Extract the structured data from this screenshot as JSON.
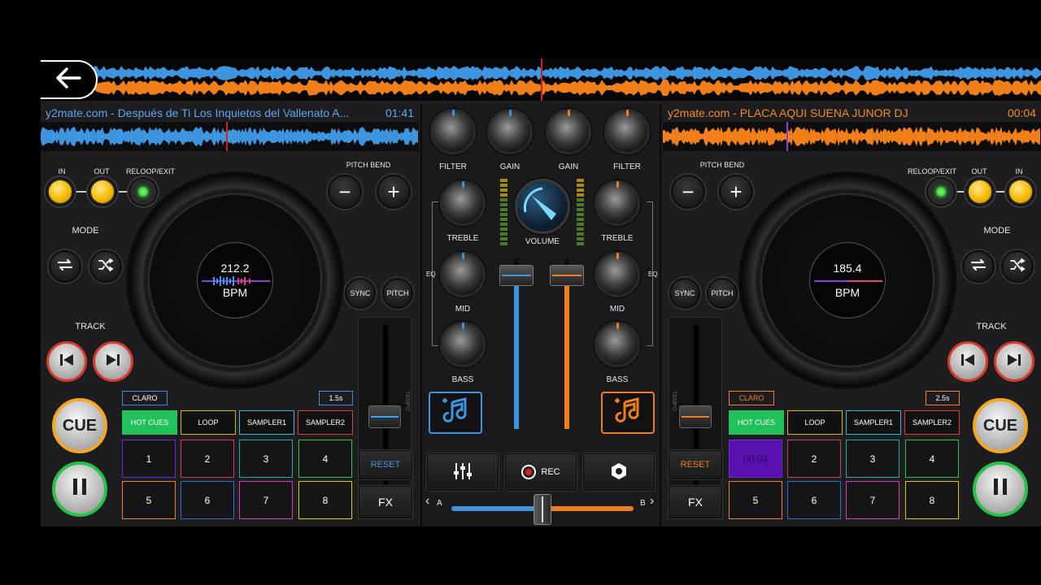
{
  "colors": {
    "deck_a": "#3d95e0",
    "deck_b": "#f07f1a",
    "cue_ring": "#f5a623",
    "play_ring": "#27c246",
    "track_ring": "#d83b2b",
    "hot_cues": "#22c05a",
    "active_pad": "#5a0fb0"
  },
  "nav": {
    "back_icon": "arrow-left-icon"
  },
  "deck_a": {
    "title": "y2mate.com - Después de Ti  Los Inquietos del Vallenato A...",
    "time": "01:41",
    "in_label": "IN",
    "out_label": "OUT",
    "reloop_label": "RELOOP/EXIT",
    "pitch_bend_label": "PITCH BEND",
    "sync_label": "SYNC",
    "pitch_label": "PITCH",
    "mode_label": "MODE",
    "track_label": "TRACK",
    "bpm_value": "212.2",
    "bpm_label": "BPM",
    "tempo_label": "TEMPO",
    "cue_label": "CUE",
    "claro_label": "CLARO",
    "length_label": "1.5s",
    "tabs": [
      "HOT CUES",
      "LOOP",
      "SAMPLER1",
      "SAMPLER2"
    ],
    "pads": [
      "1",
      "2",
      "3",
      "4",
      "5",
      "6",
      "7",
      "8"
    ],
    "reset_label": "RESET",
    "fx_label": "FX"
  },
  "deck_b": {
    "title": "y2mate.com - PLACA AQUI SUENA JUNOR DJ",
    "time": "00:04",
    "in_label": "IN",
    "out_label": "OUT",
    "reloop_label": "RELOOP/EXIT",
    "pitch_bend_label": "PITCH BEND",
    "sync_label": "SYNC",
    "pitch_label": "PITCH",
    "mode_label": "MODE",
    "track_label": "TRACK",
    "bpm_value": "185.4",
    "bpm_label": "BPM",
    "tempo_label": "TEMPO",
    "cue_label": "CUE",
    "claro_label": "CLARO",
    "length_label": "2.5s",
    "tabs": [
      "HOT CUES",
      "LOOP",
      "SAMPLER1",
      "SAMPLER2"
    ],
    "pads": [
      "00:04",
      "2",
      "3",
      "4",
      "5",
      "6",
      "7",
      "8"
    ],
    "reset_label": "RESET",
    "fx_label": "FX"
  },
  "mixer": {
    "filter_label": "FILTER",
    "gain_label": "GAIN",
    "treble_label": "TREBLE",
    "mid_label": "MID",
    "bass_label": "BASS",
    "volume_label": "VOLUME",
    "eq_label": "EQ",
    "rec_label": "REC",
    "crossfader_a": "A",
    "crossfader_b": "B",
    "crossfader_position": 0.5,
    "channel_a_volume": 0.9,
    "channel_b_volume": 0.9
  }
}
